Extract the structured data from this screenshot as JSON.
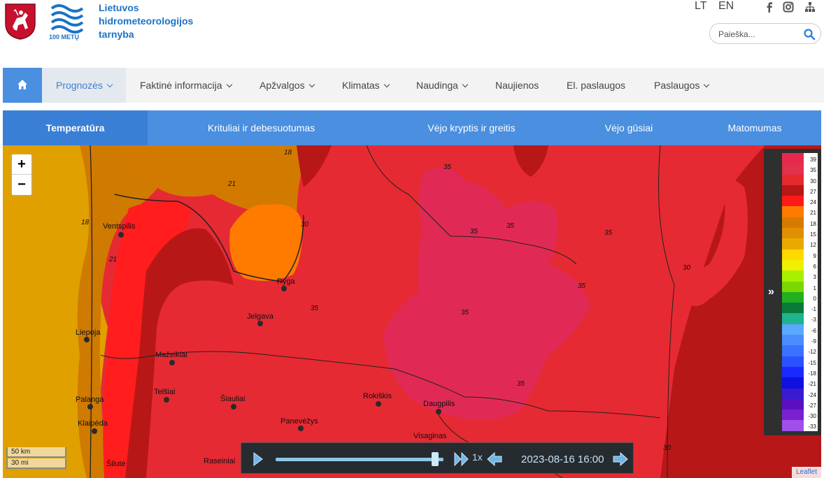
{
  "header": {
    "org_name_lines": [
      "Lietuvos",
      "hidrometeorologijos",
      "tarnyba"
    ],
    "logo_caption": "100 METŲ",
    "lang_lt": "LT",
    "lang_en": "EN",
    "search_placeholder": "Paieška..."
  },
  "nav": {
    "items": [
      {
        "label": "Prognozės"
      },
      {
        "label": "Faktinė informacija"
      },
      {
        "label": "Apžvalgos"
      },
      {
        "label": "Klimatas"
      },
      {
        "label": "Naudinga"
      },
      {
        "label": "Naujienos"
      },
      {
        "label": "El. paslaugos"
      },
      {
        "label": "Paslaugos"
      }
    ]
  },
  "subtabs": [
    {
      "label": "Temperatūra"
    },
    {
      "label": "Krituliai ir debesuotumas"
    },
    {
      "label": "Vėjo kryptis ir greitis"
    },
    {
      "label": "Vėjo gūsiai"
    },
    {
      "label": "Matomumas"
    }
  ],
  "map": {
    "zoom_in": "+",
    "zoom_out": "−",
    "cities": [
      "Ventspilis",
      "Ryga",
      "Jelgava",
      "Liepoja",
      "Mažeikiai",
      "Telšiai",
      "Šiauliai",
      "Palanga",
      "Klaipėda",
      "Rokiškis",
      "Daugpilis",
      "Panevėžys",
      "Visaginas",
      "Raseiniai",
      "Šilutė"
    ],
    "contours": [
      "21",
      "18",
      "21",
      "18",
      "30",
      "35",
      "35",
      "35",
      "35",
      "35",
      "35",
      "35",
      "30",
      "35",
      "30"
    ],
    "legend": {
      "toggle": "»",
      "values": [
        "39",
        "35",
        "30",
        "27",
        "24",
        "21",
        "18",
        "15",
        "12",
        "9",
        "6",
        "3",
        "1",
        "0",
        "-1",
        "-3",
        "-6",
        "-9",
        "-12",
        "-15",
        "-18",
        "-21",
        "-24",
        "-27",
        "-30",
        "-33"
      ],
      "colors": [
        "#e8294f",
        "#e0324a",
        "#e52a2f",
        "#b81717",
        "#ff1a1a",
        "#ff7a00",
        "#d87a00",
        "#e08f00",
        "#e8aa00",
        "#ffd800",
        "#f0f000",
        "#a8f000",
        "#7ad800",
        "#22b022",
        "#0a7a3a",
        "#1fb38e",
        "#5aa8ff",
        "#4a8dff",
        "#3a72ff",
        "#2a52ff",
        "#1a2aff",
        "#1010e0",
        "#3a1ad0",
        "#5a10c0",
        "#7a20d0",
        "#a050e8"
      ]
    },
    "scale_km": "50 km",
    "scale_mi": "30 mi",
    "attribution": "Leaflet"
  },
  "player": {
    "speed": "1x",
    "timestamp": "2023-08-16 16:00",
    "progress": 0.95
  },
  "colors": {
    "brand_blue": "#4a8fe0",
    "map_red": "#e62a33"
  }
}
